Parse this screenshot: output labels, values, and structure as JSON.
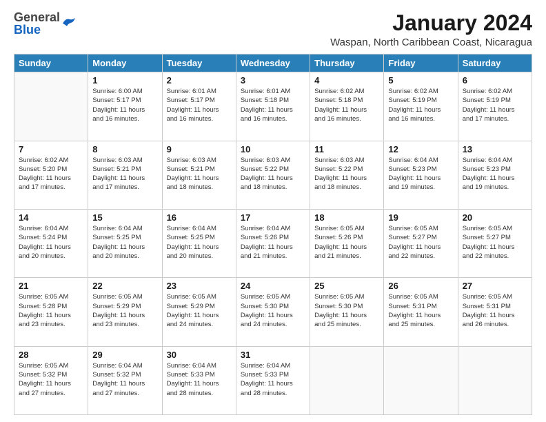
{
  "header": {
    "logo_general": "General",
    "logo_blue": "Blue",
    "title": "January 2024",
    "subtitle": "Waspan, North Caribbean Coast, Nicaragua"
  },
  "weekdays": [
    "Sunday",
    "Monday",
    "Tuesday",
    "Wednesday",
    "Thursday",
    "Friday",
    "Saturday"
  ],
  "weeks": [
    [
      {
        "day": "",
        "info": ""
      },
      {
        "day": "1",
        "info": "Sunrise: 6:00 AM\nSunset: 5:17 PM\nDaylight: 11 hours\nand 16 minutes."
      },
      {
        "day": "2",
        "info": "Sunrise: 6:01 AM\nSunset: 5:17 PM\nDaylight: 11 hours\nand 16 minutes."
      },
      {
        "day": "3",
        "info": "Sunrise: 6:01 AM\nSunset: 5:18 PM\nDaylight: 11 hours\nand 16 minutes."
      },
      {
        "day": "4",
        "info": "Sunrise: 6:02 AM\nSunset: 5:18 PM\nDaylight: 11 hours\nand 16 minutes."
      },
      {
        "day": "5",
        "info": "Sunrise: 6:02 AM\nSunset: 5:19 PM\nDaylight: 11 hours\nand 16 minutes."
      },
      {
        "day": "6",
        "info": "Sunrise: 6:02 AM\nSunset: 5:19 PM\nDaylight: 11 hours\nand 17 minutes."
      }
    ],
    [
      {
        "day": "7",
        "info": "Sunrise: 6:02 AM\nSunset: 5:20 PM\nDaylight: 11 hours\nand 17 minutes."
      },
      {
        "day": "8",
        "info": "Sunrise: 6:03 AM\nSunset: 5:21 PM\nDaylight: 11 hours\nand 17 minutes."
      },
      {
        "day": "9",
        "info": "Sunrise: 6:03 AM\nSunset: 5:21 PM\nDaylight: 11 hours\nand 18 minutes."
      },
      {
        "day": "10",
        "info": "Sunrise: 6:03 AM\nSunset: 5:22 PM\nDaylight: 11 hours\nand 18 minutes."
      },
      {
        "day": "11",
        "info": "Sunrise: 6:03 AM\nSunset: 5:22 PM\nDaylight: 11 hours\nand 18 minutes."
      },
      {
        "day": "12",
        "info": "Sunrise: 6:04 AM\nSunset: 5:23 PM\nDaylight: 11 hours\nand 19 minutes."
      },
      {
        "day": "13",
        "info": "Sunrise: 6:04 AM\nSunset: 5:23 PM\nDaylight: 11 hours\nand 19 minutes."
      }
    ],
    [
      {
        "day": "14",
        "info": "Sunrise: 6:04 AM\nSunset: 5:24 PM\nDaylight: 11 hours\nand 20 minutes."
      },
      {
        "day": "15",
        "info": "Sunrise: 6:04 AM\nSunset: 5:25 PM\nDaylight: 11 hours\nand 20 minutes."
      },
      {
        "day": "16",
        "info": "Sunrise: 6:04 AM\nSunset: 5:25 PM\nDaylight: 11 hours\nand 20 minutes."
      },
      {
        "day": "17",
        "info": "Sunrise: 6:04 AM\nSunset: 5:26 PM\nDaylight: 11 hours\nand 21 minutes."
      },
      {
        "day": "18",
        "info": "Sunrise: 6:05 AM\nSunset: 5:26 PM\nDaylight: 11 hours\nand 21 minutes."
      },
      {
        "day": "19",
        "info": "Sunrise: 6:05 AM\nSunset: 5:27 PM\nDaylight: 11 hours\nand 22 minutes."
      },
      {
        "day": "20",
        "info": "Sunrise: 6:05 AM\nSunset: 5:27 PM\nDaylight: 11 hours\nand 22 minutes."
      }
    ],
    [
      {
        "day": "21",
        "info": "Sunrise: 6:05 AM\nSunset: 5:28 PM\nDaylight: 11 hours\nand 23 minutes."
      },
      {
        "day": "22",
        "info": "Sunrise: 6:05 AM\nSunset: 5:29 PM\nDaylight: 11 hours\nand 23 minutes."
      },
      {
        "day": "23",
        "info": "Sunrise: 6:05 AM\nSunset: 5:29 PM\nDaylight: 11 hours\nand 24 minutes."
      },
      {
        "day": "24",
        "info": "Sunrise: 6:05 AM\nSunset: 5:30 PM\nDaylight: 11 hours\nand 24 minutes."
      },
      {
        "day": "25",
        "info": "Sunrise: 6:05 AM\nSunset: 5:30 PM\nDaylight: 11 hours\nand 25 minutes."
      },
      {
        "day": "26",
        "info": "Sunrise: 6:05 AM\nSunset: 5:31 PM\nDaylight: 11 hours\nand 25 minutes."
      },
      {
        "day": "27",
        "info": "Sunrise: 6:05 AM\nSunset: 5:31 PM\nDaylight: 11 hours\nand 26 minutes."
      }
    ],
    [
      {
        "day": "28",
        "info": "Sunrise: 6:05 AM\nSunset: 5:32 PM\nDaylight: 11 hours\nand 27 minutes."
      },
      {
        "day": "29",
        "info": "Sunrise: 6:04 AM\nSunset: 5:32 PM\nDaylight: 11 hours\nand 27 minutes."
      },
      {
        "day": "30",
        "info": "Sunrise: 6:04 AM\nSunset: 5:33 PM\nDaylight: 11 hours\nand 28 minutes."
      },
      {
        "day": "31",
        "info": "Sunrise: 6:04 AM\nSunset: 5:33 PM\nDaylight: 11 hours\nand 28 minutes."
      },
      {
        "day": "",
        "info": ""
      },
      {
        "day": "",
        "info": ""
      },
      {
        "day": "",
        "info": ""
      }
    ]
  ]
}
